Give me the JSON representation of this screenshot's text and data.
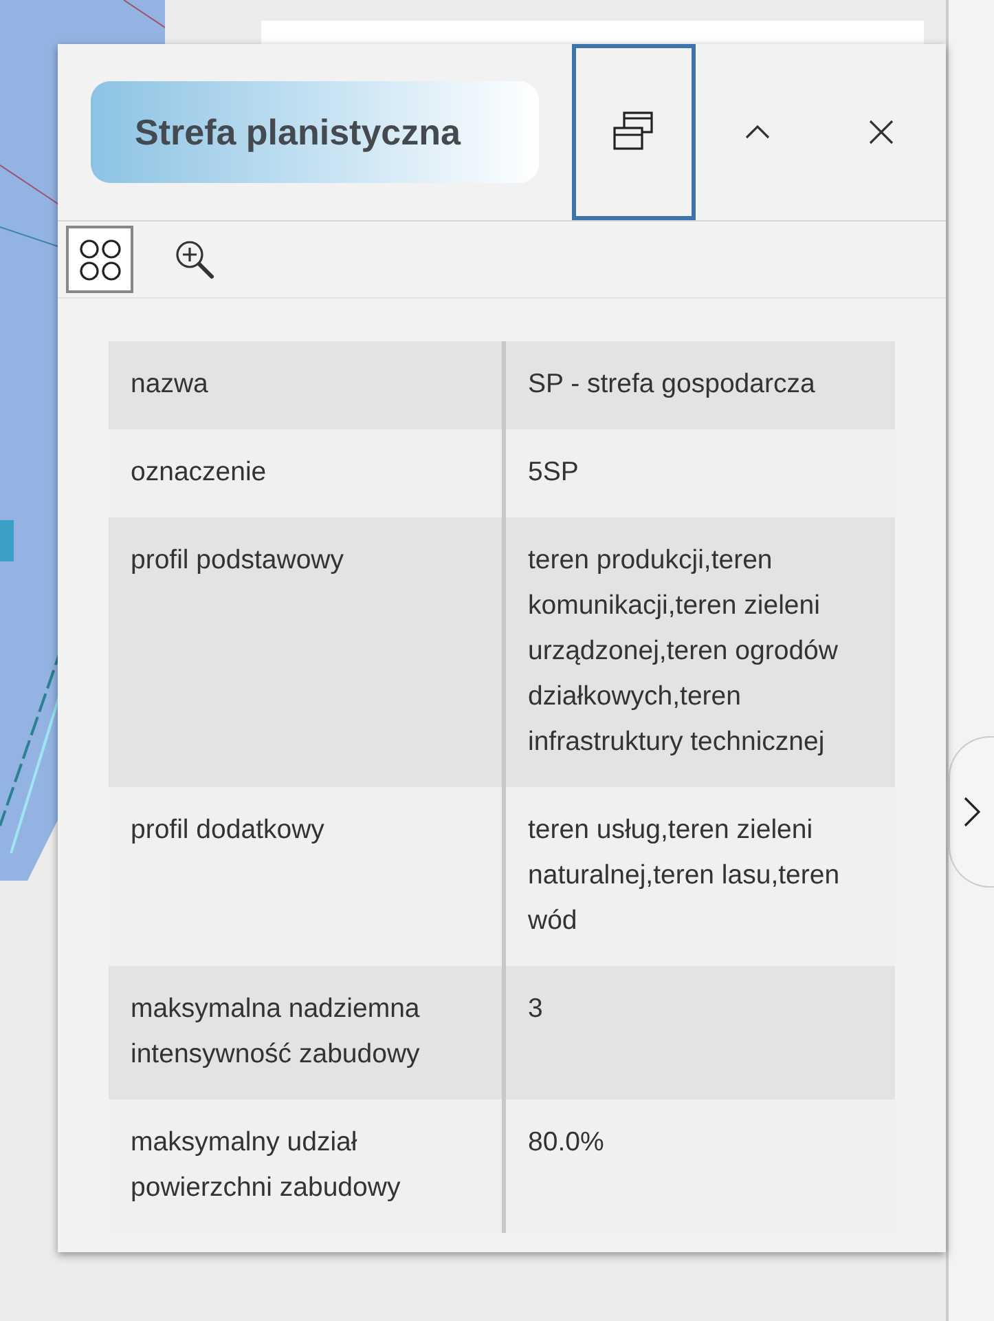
{
  "popup": {
    "title": "Strefa planistyczna",
    "header_buttons": [
      {
        "kind": "restore",
        "selected": true
      },
      {
        "kind": "collapse",
        "selected": false
      },
      {
        "kind": "close",
        "selected": false
      }
    ],
    "tools": [
      {
        "kind": "features",
        "selected": true
      },
      {
        "kind": "zoom",
        "selected": false
      }
    ],
    "attributes": [
      {
        "label": "nazwa",
        "value": "SP - strefa gospodarcza"
      },
      {
        "label": "oznaczenie",
        "value": "5SP"
      },
      {
        "label": "profil podstawowy",
        "value": "teren produkcji,teren komunikacji,teren zieleni urządzonej,teren ogrodów działkowych,teren infrastruktury technicznej"
      },
      {
        "label": "profil dodatkowy",
        "value": "teren usług,teren zieleni naturalnej,teren lasu,teren wód"
      },
      {
        "label": "maksymalna nadziemna intensywność zabudowy",
        "value": "3"
      },
      {
        "label": "maksymalny udział powierzchni zabudowy",
        "value": "80.0%"
      }
    ]
  }
}
